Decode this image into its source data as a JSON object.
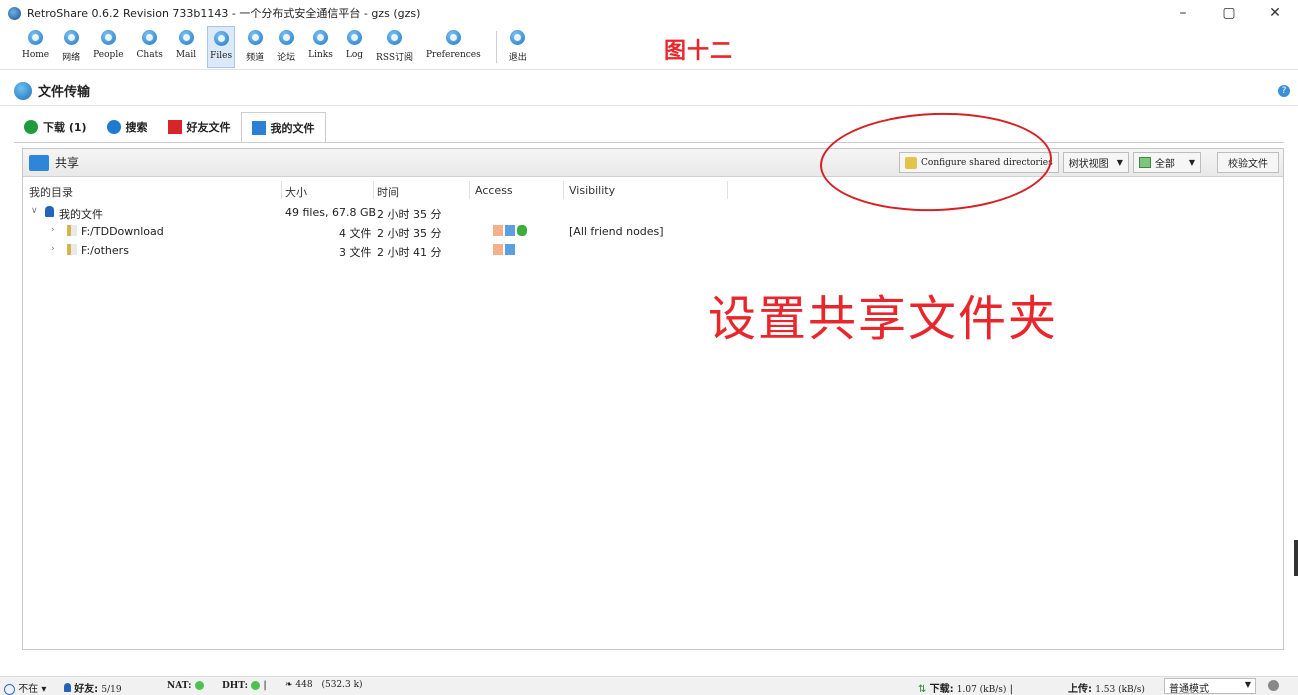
{
  "window": {
    "title": "RetroShare 0.6.2 Revision 733b1143 - 一个分布式安全通信平台 - gzs (gzs)",
    "controls": [
      "–",
      "▢",
      "✕"
    ]
  },
  "toolbar": {
    "items": [
      {
        "label": "Home",
        "icon": "home-icon"
      },
      {
        "label": "网络",
        "icon": "network-icon"
      },
      {
        "label": "People",
        "icon": "people-icon"
      },
      {
        "label": "Chats",
        "icon": "chats-icon"
      },
      {
        "label": "Mail",
        "icon": "mail-icon"
      },
      {
        "label": "Files",
        "icon": "files-icon",
        "active": true
      },
      {
        "label": "频道",
        "icon": "channels-icon"
      },
      {
        "label": "论坛",
        "icon": "forums-icon"
      },
      {
        "label": "Links",
        "icon": "links-icon"
      },
      {
        "label": "Log",
        "icon": "log-icon"
      },
      {
        "label": "RSS订阅",
        "icon": "rss-icon"
      },
      {
        "label": "Preferences",
        "icon": "preferences-icon"
      }
    ],
    "exit_label": "退出"
  },
  "annotations": {
    "figure_label": "图十二",
    "main_caption": "设置共享文件夹"
  },
  "header": {
    "title": "文件传输",
    "help": "?"
  },
  "tabs": [
    {
      "label": "下载 (1)",
      "icon": "download-icon"
    },
    {
      "label": "搜索",
      "icon": "search-icon"
    },
    {
      "label": "好友文件",
      "icon": "friends-files-icon"
    },
    {
      "label": "我的文件",
      "icon": "my-files-icon",
      "active": true
    }
  ],
  "panel": {
    "title": "共享",
    "configure_button": "Configure shared directories",
    "view_select": "树状视图",
    "filter_select": "全部",
    "check_button": "校验文件"
  },
  "columns": [
    "我的目录",
    "大小",
    "时间",
    "Access",
    "Visibility"
  ],
  "rows": [
    {
      "name": "我的文件",
      "size": "49 files, 67.8 GB",
      "time": "2 小时 35 分",
      "access": [],
      "visibility": ""
    },
    {
      "name": "F:/TDDownload",
      "size": "4 文件",
      "time": "2 小时 35 分",
      "access": [
        "a",
        "b",
        "c"
      ],
      "visibility": "[All friend nodes]"
    },
    {
      "name": "F:/others",
      "size": "3 文件",
      "time": "2 小时 41 分",
      "access": [
        "a",
        "b"
      ],
      "visibility": ""
    }
  ],
  "status": {
    "online": "不在",
    "friends_label": "好友:",
    "friends_value": "5/19",
    "nat_label": "NAT:",
    "dht_label": "DHT:",
    "peers": "448",
    "peers_extra": "(532.3 k)",
    "download_label": "下载:",
    "download_value": "1.07 (kB/s)",
    "upload_label": "上传:",
    "upload_value": "1.53 (kB/s)",
    "mode": "普通模式"
  }
}
